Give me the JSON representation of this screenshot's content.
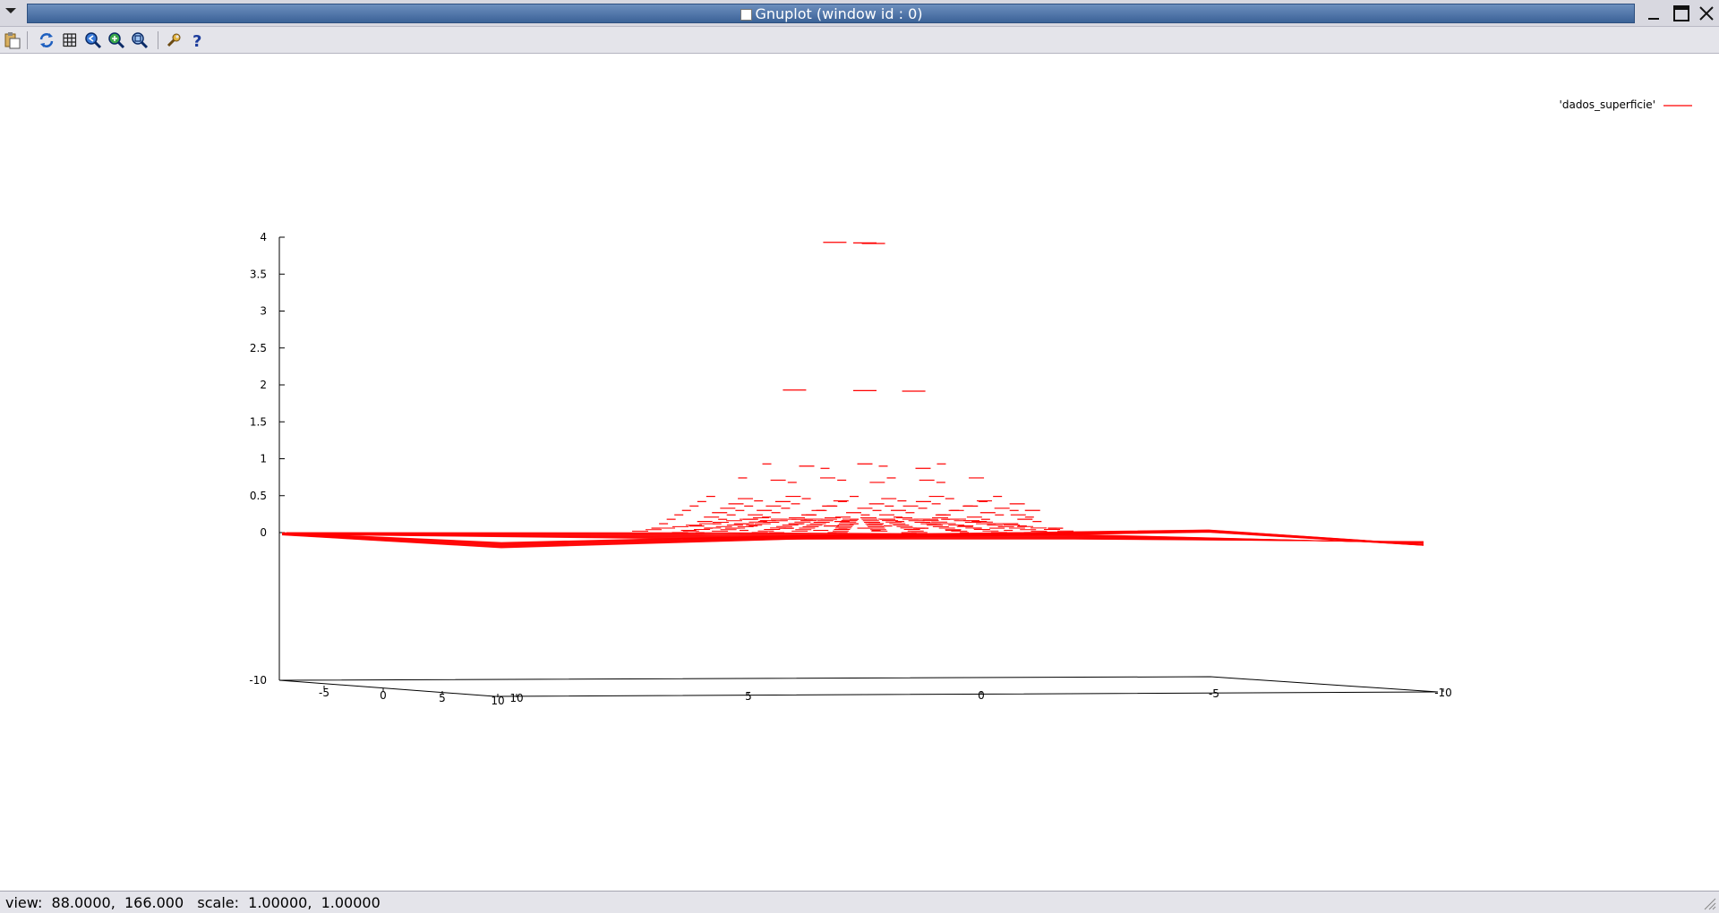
{
  "window": {
    "title": "Gnuplot (window id : 0)",
    "controls": {
      "minimize": "minimize-icon",
      "maximize": "maximize-icon",
      "close": "close-icon"
    }
  },
  "toolbar": {
    "items": [
      {
        "name": "copy-to-clipboard",
        "icon": "clipboard-icon"
      },
      {
        "name": "replot",
        "icon": "refresh-icon"
      },
      {
        "name": "toggle-grid",
        "icon": "grid-icon"
      },
      {
        "name": "zoom-previous",
        "icon": "zoom-previous-icon"
      },
      {
        "name": "zoom-next",
        "icon": "zoom-next-icon"
      },
      {
        "name": "autoscale",
        "icon": "zoom-autoscale-icon"
      },
      {
        "name": "options",
        "icon": "wrench-icon"
      },
      {
        "name": "help",
        "icon": "help-icon"
      }
    ]
  },
  "statusbar": {
    "text": "view:  88.0000,  166.000   scale:  1.00000,  1.00000"
  },
  "colors": {
    "series": "#ff0000",
    "axis": "#000000",
    "titlebar": "#3b6297"
  },
  "chart_data": {
    "type": "surface",
    "legend": "'dados_superficie'",
    "legend_position": "top-right",
    "view": {
      "rot_x": 88.0,
      "rot_z": 166.0,
      "scale": [
        1.0,
        1.0
      ]
    },
    "z_ticks": [
      "4",
      "3.5",
      "3",
      "2.5",
      "2",
      "1.5",
      "1",
      "0.5",
      "0",
      "-10"
    ],
    "x_ticks": [
      "-5",
      "0",
      "5",
      "10"
    ],
    "y_ticks": [
      "10",
      "5",
      "0",
      "-5",
      "-10"
    ],
    "xrange": [
      -10,
      10
    ],
    "yrange": [
      -10,
      10
    ],
    "zrange": [
      0,
      4
    ],
    "grid": false,
    "peak": {
      "x": 0,
      "y": 0,
      "z": 3.93
    },
    "levels": [
      3.93,
      1.93,
      0.93,
      0.74,
      0.49,
      0.42,
      0.36,
      0.3,
      0.24,
      0.18,
      0.12,
      0.06,
      0.0
    ]
  }
}
